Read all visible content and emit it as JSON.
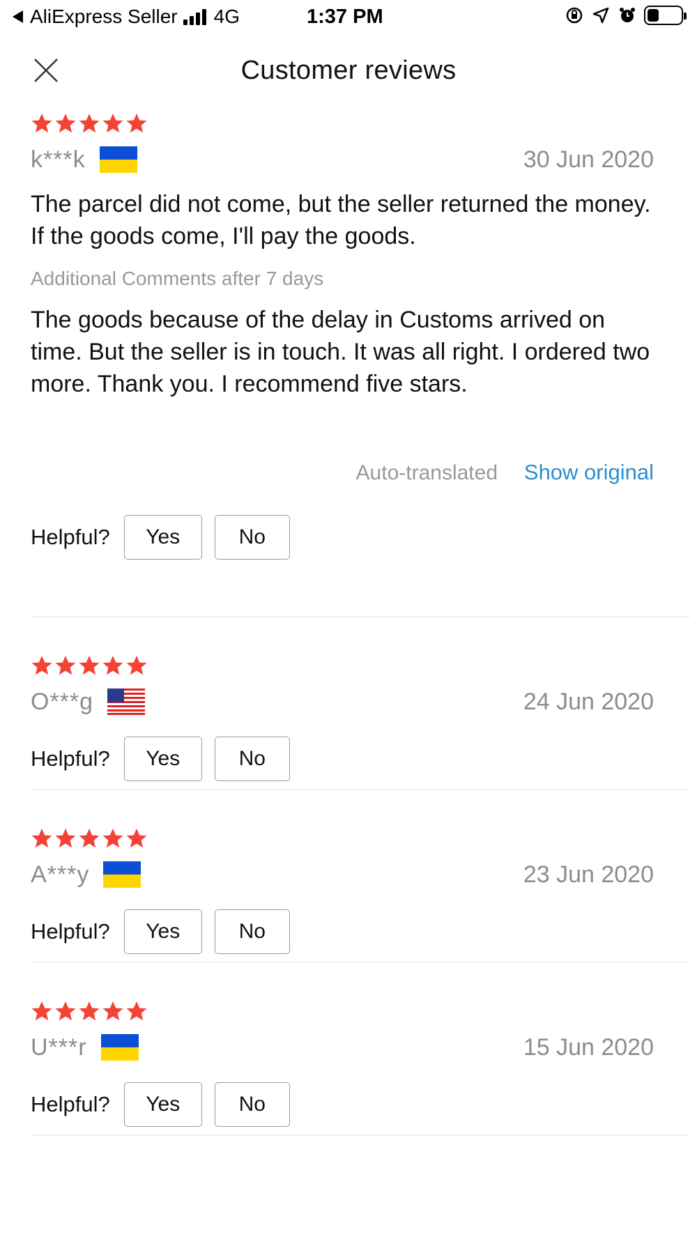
{
  "status_bar": {
    "carrier": "AliExpress Seller",
    "network": "4G",
    "time": "1:37 PM",
    "battery_level_fraction": 0.35,
    "icons": [
      "back-arrow-icon",
      "signal-icon",
      "orientation-lock-icon",
      "location-icon",
      "alarm-icon",
      "battery-icon"
    ]
  },
  "header": {
    "title": "Customer reviews",
    "close_icon": "close-icon"
  },
  "labels": {
    "helpful": "Helpful?",
    "yes": "Yes",
    "no": "No",
    "additional_comments": "Additional Comments after 7 days",
    "auto_translated": "Auto-translated",
    "show_original": "Show original"
  },
  "colors": {
    "star": "#f44336",
    "link": "#2c8fd0",
    "muted_text": "#8c8c8c"
  },
  "reviews": [
    {
      "rating": 5,
      "reviewer": "k***k",
      "country_flag": "ukraine",
      "date": "30 Jun 2020",
      "text": "The parcel did not come, but the seller returned the money. If the goods come, I'll pay the goods.",
      "additional_text": "The goods because of the delay in Customs arrived on time. But the seller is in touch. It was all right. I ordered two more. Thank you. I recommend five stars."
    },
    {
      "rating": 5,
      "reviewer": "O***g",
      "country_flag": "usa",
      "date": "24 Jun 2020"
    },
    {
      "rating": 5,
      "reviewer": "A***y",
      "country_flag": "ukraine",
      "date": "23 Jun 2020"
    },
    {
      "rating": 5,
      "reviewer": "U***r",
      "country_flag": "ukraine",
      "date": "15 Jun 2020"
    }
  ]
}
